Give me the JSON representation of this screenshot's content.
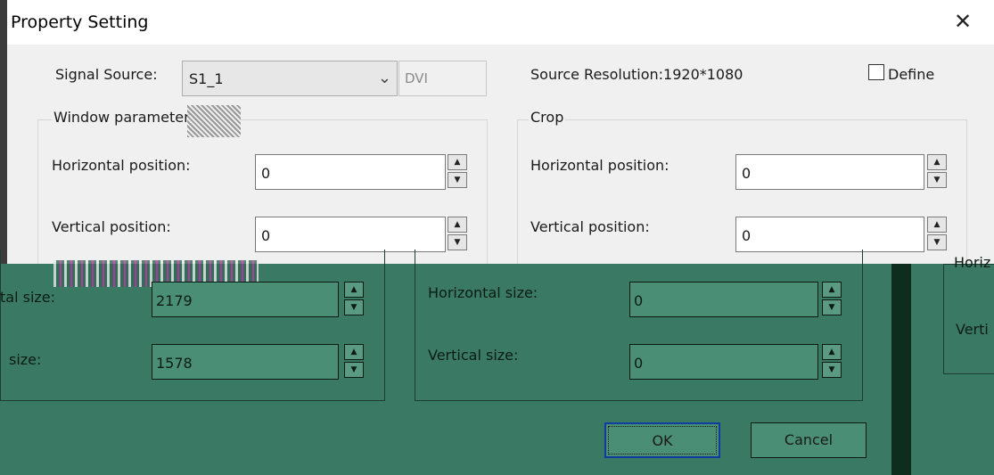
{
  "window": {
    "title": "Property Setting",
    "close_glyph": "✕"
  },
  "signal": {
    "label": "Signal Source:",
    "value": "S1_1",
    "type_value": "DVI",
    "resolution_label": "Source Resolution:1920*1080",
    "define_label": "Define",
    "define_checked": false
  },
  "window_params": {
    "legend": "Window parameter",
    "horizontal_position_label": "Horizontal position:",
    "horizontal_position_value": "0",
    "vertical_position_label": "Vertical position:",
    "vertical_position_value": "0",
    "horizontal_size_label": "tal size:",
    "horizontal_size_value": "2179",
    "vertical_size_label": "size:",
    "vertical_size_value": "1578"
  },
  "crop": {
    "legend": "Crop",
    "horizontal_position_label": "Horizontal position:",
    "horizontal_position_value": "0",
    "vertical_position_label": "Vertical position:",
    "vertical_position_value": "0",
    "horizontal_size_label": "Horizontal size:",
    "horizontal_size_value": "0",
    "vertical_size_label": "Vertical size:",
    "vertical_size_value": "0"
  },
  "buttons": {
    "ok": "OK",
    "cancel": "Cancel"
  },
  "right_strip": {
    "label1": "Horiz",
    "label2": "Verti"
  },
  "icons": {
    "spin_up": "▲",
    "spin_down": "▼",
    "combo_arrow": "chevron-down-icon"
  },
  "colors": {
    "dialog_bg": "#f0f0f0",
    "overlay_green": "#3a7a64",
    "dark_band": "#0e2d1f"
  }
}
